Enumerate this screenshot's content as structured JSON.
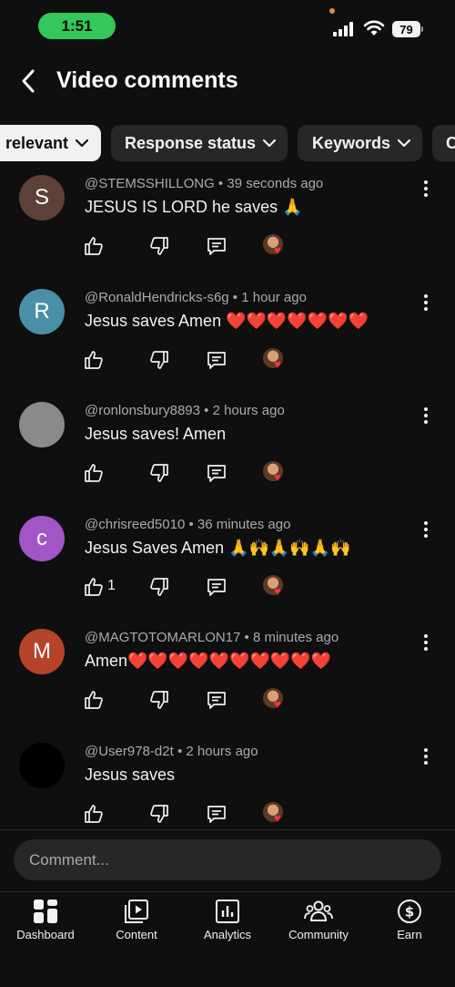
{
  "status_bar": {
    "time": "1:51",
    "battery": "79"
  },
  "header": {
    "title": "Video comments"
  },
  "chips": [
    {
      "label": "relevant"
    },
    {
      "label": "Response status"
    },
    {
      "label": "Keywords"
    },
    {
      "label": "C"
    }
  ],
  "comments": [
    {
      "avatar_letter": "S",
      "avatar_color": "#5d4037",
      "author": "@STEMSSHILLONG",
      "time": "39 seconds ago",
      "text": "JESUS IS LORD he saves 🙏",
      "likes": ""
    },
    {
      "avatar_letter": "R",
      "avatar_color": "#4a90a4",
      "author": "@RonaldHendricks-s6g",
      "time": "1 hour ago",
      "text": "Jesus saves Amen ❤️❤️❤️❤️❤️❤️❤️",
      "likes": ""
    },
    {
      "avatar_letter": "",
      "avatar_color": "#8a8a8a",
      "author": "@ronlonsbury8893",
      "time": "2 hours ago",
      "text": "Jesus saves! Amen",
      "likes": ""
    },
    {
      "avatar_letter": "c",
      "avatar_color": "#a155c7",
      "author": "@chrisreed5010",
      "time": "36 minutes ago",
      "text": "Jesus Saves Amen 🙏🙌🙏🙌🙏🙌",
      "likes": "1"
    },
    {
      "avatar_letter": "M",
      "avatar_color": "#b5432a",
      "author": "@MAGTOTOMARLON17",
      "time": "8 minutes ago",
      "text": "Amen❤️❤️❤️❤️❤️❤️❤️❤️❤️❤️",
      "likes": ""
    },
    {
      "avatar_letter": "",
      "avatar_color": "#000000",
      "author": "@User978-d2t",
      "time": "2 hours ago",
      "text": "Jesus saves",
      "likes": ""
    }
  ],
  "comment_input": {
    "placeholder": "Comment..."
  },
  "nav": [
    {
      "label": "Dashboard",
      "icon": "dashboard-icon"
    },
    {
      "label": "Content",
      "icon": "content-icon"
    },
    {
      "label": "Analytics",
      "icon": "analytics-icon"
    },
    {
      "label": "Community",
      "icon": "community-icon"
    },
    {
      "label": "Earn",
      "icon": "earn-icon"
    }
  ]
}
